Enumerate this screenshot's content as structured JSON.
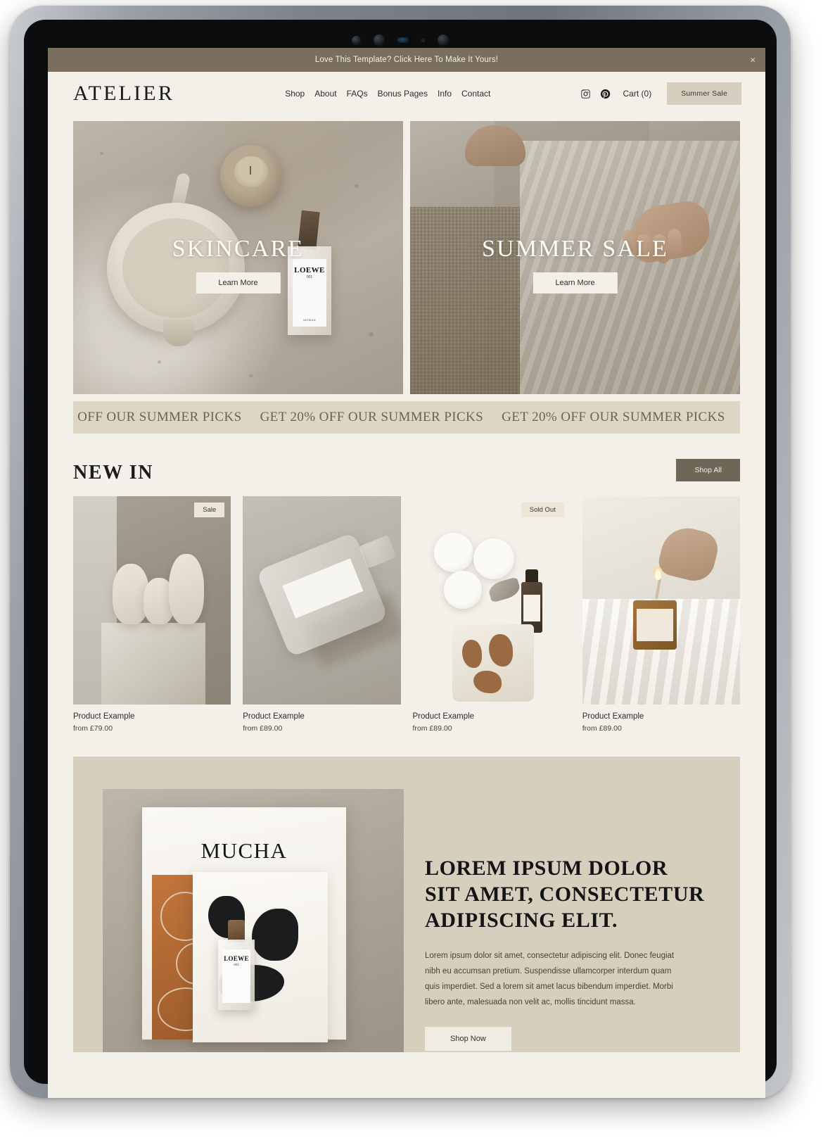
{
  "announcement": {
    "text": "Love This Template? Click Here To Make It Yours!",
    "close_label": "×"
  },
  "header": {
    "brand": "ATELIER",
    "nav": [
      {
        "label": "Shop"
      },
      {
        "label": "About"
      },
      {
        "label": "FAQs"
      },
      {
        "label": "Bonus Pages"
      },
      {
        "label": "Info"
      },
      {
        "label": "Contact"
      }
    ],
    "social": [
      {
        "name": "instagram-icon"
      },
      {
        "name": "pinterest-icon"
      }
    ],
    "cart_label": "Cart (0)",
    "summer_sale_label": "Summer Sale"
  },
  "hero": [
    {
      "title": "SKINCARE",
      "button": "Learn More",
      "perfume_brand": "LOEWE",
      "perfume_sub": "001",
      "perfume_foot": "WOMAN"
    },
    {
      "title": "SUMMER SALE",
      "button": "Learn More"
    }
  ],
  "marquee": {
    "text": "GET 20% OFF OUR SUMMER PICKS",
    "repeat_count": 5
  },
  "new_in": {
    "title": "NEW IN",
    "shop_all_label": "Shop All",
    "products": [
      {
        "name": "Product Example",
        "price": "from £79.00",
        "badge": "Sale"
      },
      {
        "name": "Product Example",
        "price": "from £89.00",
        "badge": ""
      },
      {
        "name": "Product Example",
        "price": "from £89.00",
        "badge": "Sold Out"
      },
      {
        "name": "Product Example",
        "price": "from £89.00",
        "badge": ""
      }
    ]
  },
  "promo": {
    "magazine_title": "MUCHA",
    "perfume_brand": "LOEWE",
    "perfume_sub": "001",
    "heading": "LOREM IPSUM DOLOR SIT AMET, CONSECTETUR ADIPISCING ELIT.",
    "body": "Lorem ipsum dolor sit amet, consectetur adipiscing elit. Donec feugiat nibh eu accumsan pretium. Suspendisse ullamcorper interdum quam quis imperdiet. Sed a lorem sit amet lacus bibendum imperdiet. Morbi libero ante, malesuada non velit ac, mollis tincidunt massa.",
    "shop_now_label": "Shop Now"
  },
  "colors": {
    "page_bg": "#f3f0e9",
    "announcement_bg": "#7a6e5f",
    "accent_button": "#6f6657",
    "sale_button": "#d6cfbf",
    "marquee_bg": "#ddd6c4",
    "promo_bg": "#d6cfbe"
  }
}
